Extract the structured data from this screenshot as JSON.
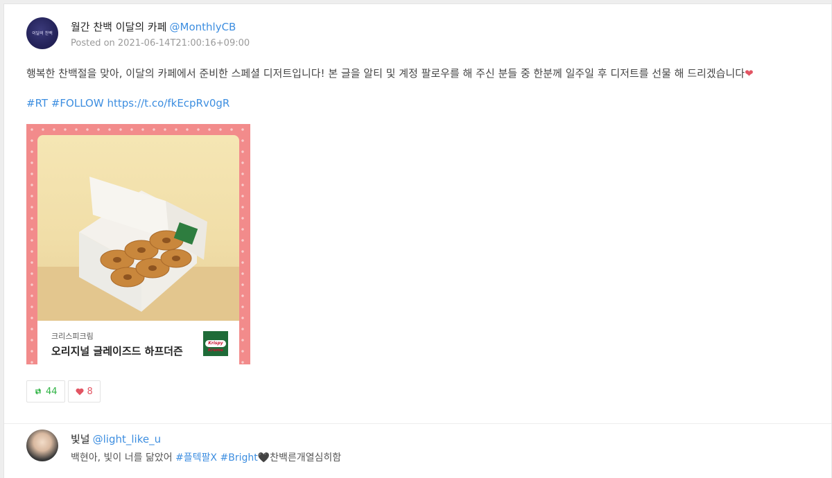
{
  "post": {
    "author_name": "월간 찬백 이달의 카페",
    "author_handle": "@MonthlyCB",
    "avatar_text": "이달의 찬백",
    "posted_label": "Posted on 2021-06-14T21:00:16+09:00",
    "body": "행복한 찬백절을 맞아, 이달의 카페에서 준비한 스페셜 디저트입니다! 본 글을 알티 및 계정 팔로우를 해 주신 분들 중 한분께 일주일 후 디저트를 선물 해 드리겠습니다",
    "body_emoji": "❤",
    "tag_rt": "#RT",
    "tag_follow": "#FOLLOW",
    "link": "https://t.co/fkEcpRv0gR",
    "media": {
      "brand": "크리스피크림",
      "product": "오리지널 글레이즈드 하프더즌",
      "logo_text": "Krispy Kreme"
    },
    "retweet_count": "44",
    "like_count": "8"
  },
  "reply": {
    "author_name": "빛널",
    "author_handle": "@light_like_u",
    "text_before": "백현아, 빛이 너를 닮았어",
    "tag1": "#플텍팔X",
    "tag2": "#Bright",
    "text_after": "🖤찬백른개열심히함"
  },
  "colors": {
    "link": "#3d8ee0",
    "retweet": "#2fb344",
    "like": "#e25563",
    "media_frame": "#f28b8b"
  }
}
